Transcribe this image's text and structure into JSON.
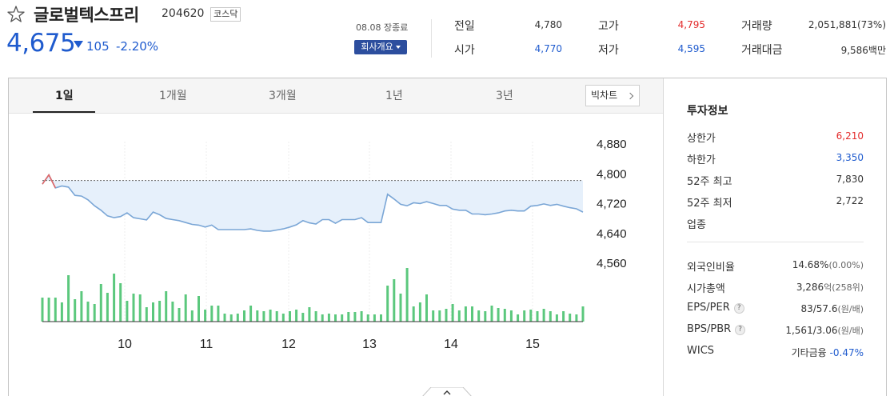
{
  "header": {
    "name": "글로벌텍스프리",
    "code": "204620",
    "market": "코스닥",
    "price": "4,675",
    "change": "105",
    "change_rate": "-2.20%",
    "status": "08.08 장종료",
    "company_btn": "회사개요"
  },
  "quote": {
    "prev_close_label": "전일",
    "prev_close": "4,780",
    "open_label": "시가",
    "open": "4,770",
    "high_label": "고가",
    "high": "4,795",
    "low_label": "저가",
    "low": "4,595",
    "volume_label": "거래량",
    "volume": "2,051,881(73%)",
    "amount_label": "거래대금",
    "amount": "9,586백만"
  },
  "tabs": [
    "1일",
    "1개월",
    "3개월",
    "1년",
    "3년"
  ],
  "big_chart_label": "빅차트",
  "chart_data": {
    "type": "line",
    "title": "",
    "x_ticks": [
      "10",
      "11",
      "12",
      "13",
      "14",
      "15"
    ],
    "y_ticks": [
      "4,880",
      "4,800",
      "4,720",
      "4,640",
      "4,560"
    ],
    "ylim": [
      4560,
      4880
    ],
    "prev_close": 4780,
    "grid": true,
    "price_series": [
      4770,
      4795,
      4760,
      4765,
      4762,
      4740,
      4738,
      4728,
      4712,
      4700,
      4685,
      4680,
      4683,
      4693,
      4680,
      4677,
      4674,
      4695,
      4688,
      4678,
      4675,
      4672,
      4667,
      4662,
      4660,
      4655,
      4660,
      4648,
      4648,
      4648,
      4648,
      4648,
      4650,
      4646,
      4644,
      4644,
      4647,
      4650,
      4655,
      4661,
      4672,
      4666,
      4663,
      4675,
      4675,
      4665,
      4675,
      4675,
      4675,
      4680,
      4667,
      4667,
      4667,
      4743,
      4730,
      4716,
      4712,
      4720,
      4718,
      4723,
      4718,
      4713,
      4713,
      4703,
      4700,
      4700,
      4690,
      4690,
      4688,
      4690,
      4693,
      4698,
      4700,
      4698,
      4698,
      4711,
      4713,
      4717,
      4713,
      4716,
      4711,
      4707,
      4704,
      4695
    ],
    "volume_series": [
      30,
      30,
      30,
      24,
      58,
      28,
      38,
      25,
      22,
      47,
      36,
      60,
      48,
      26,
      35,
      34,
      18,
      24,
      26,
      38,
      25,
      17,
      34,
      14,
      32,
      15,
      20,
      20,
      10,
      9,
      10,
      14,
      20,
      14,
      13,
      15,
      13,
      10,
      13,
      15,
      11,
      18,
      13,
      9,
      10,
      9,
      9,
      12,
      12,
      13,
      9,
      9,
      9,
      45,
      53,
      35,
      67,
      19,
      24,
      34,
      14,
      14,
      16,
      22,
      14,
      19,
      19,
      14,
      13,
      20,
      17,
      16,
      14,
      9,
      14,
      15,
      13,
      16,
      13,
      9,
      13,
      10,
      9,
      19
    ]
  },
  "invest_info": {
    "title": "투자정보",
    "items": [
      {
        "label": "상한가",
        "value": "6,210",
        "color": "#e32c2c"
      },
      {
        "label": "하한가",
        "value": "3,350",
        "color": "#1f5bce"
      },
      {
        "label": "52주 최고",
        "value": "7,830"
      },
      {
        "label": "52주 최저",
        "value": "2,722"
      },
      {
        "label": "업종",
        "value": ""
      }
    ],
    "items2": [
      {
        "label": "외국인비율",
        "value": "14.68%",
        "sub": "(0.00%)"
      },
      {
        "label": "시가총액",
        "value": "3,286",
        "sub": "억(258위)"
      },
      {
        "label": "EPS/PER",
        "value": "83/57.6",
        "sub": "(원/배)",
        "help": "?"
      },
      {
        "label": "BPS/PBR",
        "value": "1,561/3.06",
        "sub": "(원/배)",
        "help": "?"
      },
      {
        "label": "WICS",
        "value": "기타금융",
        "sub": "-0.47%"
      }
    ]
  }
}
